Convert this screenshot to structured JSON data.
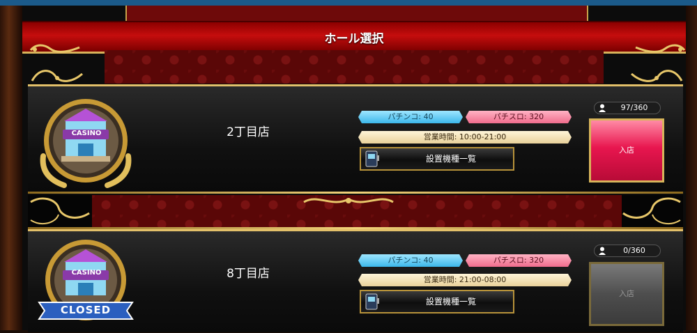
{
  "header": {
    "title": "ホール選択"
  },
  "halls": [
    {
      "name": "2丁目店",
      "badge_text": "CASINO",
      "pachinko": "パチンコ: 40",
      "pachislot": "パチスロ: 320",
      "hours": "営業時間: 10:00-21:00",
      "machines_label": "設置機種一覧",
      "occupancy": "97/360",
      "enter_label": "入店",
      "status": "open"
    },
    {
      "name": "8丁目店",
      "badge_text": "CASINO",
      "closed_label": "CLOSED",
      "pachinko": "パチンコ: 40",
      "pachislot": "パチスロ: 320",
      "hours": "営業時間: 21:00-08:00",
      "machines_label": "設置機種一覧",
      "occupancy": "0/360",
      "enter_label": "入店",
      "status": "closed"
    }
  ],
  "colors": {
    "title_red": "#c50d0d",
    "gold": "#e3c06a",
    "pachinko_tag": "#3cb7ea",
    "pachislot_tag": "#f06c8c",
    "enter_active": "#e8164f",
    "enter_disabled": "#4e4e4e"
  },
  "icons": {
    "user": "user-icon",
    "machine": "slot-machine-icon",
    "badge": "casino-building-badge"
  }
}
